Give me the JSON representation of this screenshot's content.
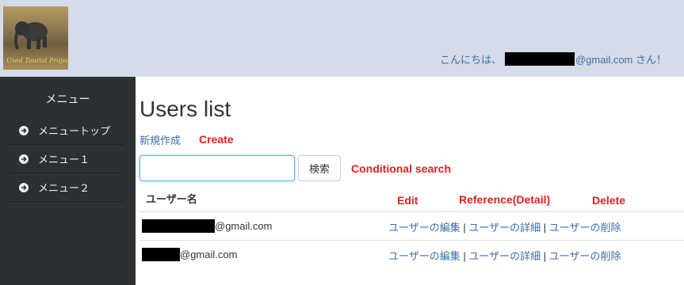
{
  "header": {
    "logo_text": "Used Tourist Project",
    "greeting_prefix": "こんにちは、",
    "greeting_suffix": "@gmail.com さん！"
  },
  "sidebar": {
    "title": "メニュー",
    "items": [
      {
        "label": "メニュートップ"
      },
      {
        "label": "メニュー１"
      },
      {
        "label": "メニュー２"
      }
    ]
  },
  "main": {
    "title": "Users list",
    "new_link": "新規作成",
    "search": {
      "placeholder": "",
      "value": "",
      "button_label": "検索"
    },
    "table": {
      "column_name": "ユーザー名",
      "rows": [
        {
          "email_suffix": "@gmail.com",
          "edit": "ユーザーの編集",
          "detail": "ユーザーの詳細",
          "delete": "ユーザーの削除",
          "sep": "|"
        },
        {
          "email_suffix": "@gmail.com",
          "edit": "ユーザーの編集",
          "detail": "ユーザーの詳細",
          "delete": "ユーザーの削除",
          "sep": "|"
        }
      ]
    }
  },
  "annotations": {
    "create": "Create",
    "search": "Conditional search",
    "edit": "Edit",
    "reference": "Reference(Detail)",
    "delete": "Delete"
  },
  "colors": {
    "header_bg": "#d6dbe9",
    "sidebar_bg": "#2b3034",
    "link": "#3a6ea5",
    "annotation": "#e02020"
  }
}
